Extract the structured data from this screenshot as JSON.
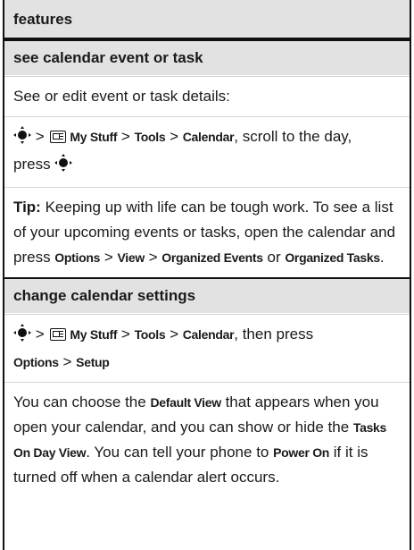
{
  "header": {
    "title": "features"
  },
  "section1": {
    "title": "see calendar event or task",
    "intro": "See or edit event or task details:",
    "path": {
      "sep1": " > ",
      "my_stuff": "My Stuff",
      "sep2": " > ",
      "tools": "Tools",
      "sep3": " > ",
      "calendar": "Calendar",
      "tail": ", scroll to the day,",
      "press": "press "
    },
    "tip": {
      "label": "Tip:",
      "text": " Keeping up with life can be tough work. To see a list of your upcoming events or tasks, open the calendar and press ",
      "options": "Options",
      "sep1": " > ",
      "view": "View",
      "sep2": " > ",
      "organized_events": "Organized Events",
      "or": " or ",
      "organized_tasks": "Organized Tasks",
      "end": "."
    }
  },
  "section2": {
    "title": "change calendar settings",
    "path": {
      "sep1": " > ",
      "my_stuff": "My Stuff",
      "sep2": " > ",
      "tools": "Tools",
      "sep3": " > ",
      "calendar": "Calendar",
      "tail": ", then press",
      "options": "Options",
      "sep4": " > ",
      "setup": "Setup"
    },
    "desc": {
      "t1": "You can choose the ",
      "default_view": "Default View",
      "t2": " that appears when you open your calendar, and you can show or hide the ",
      "tasks_on_day_view": "Tasks On Day View",
      "t3": ". You can tell your phone to ",
      "power_on": "Power On",
      "t4": " if it is turned off when a calendar alert occurs."
    }
  },
  "icons": {
    "nav": "navigation-key-icon",
    "my_stuff": "my-stuff-icon"
  }
}
